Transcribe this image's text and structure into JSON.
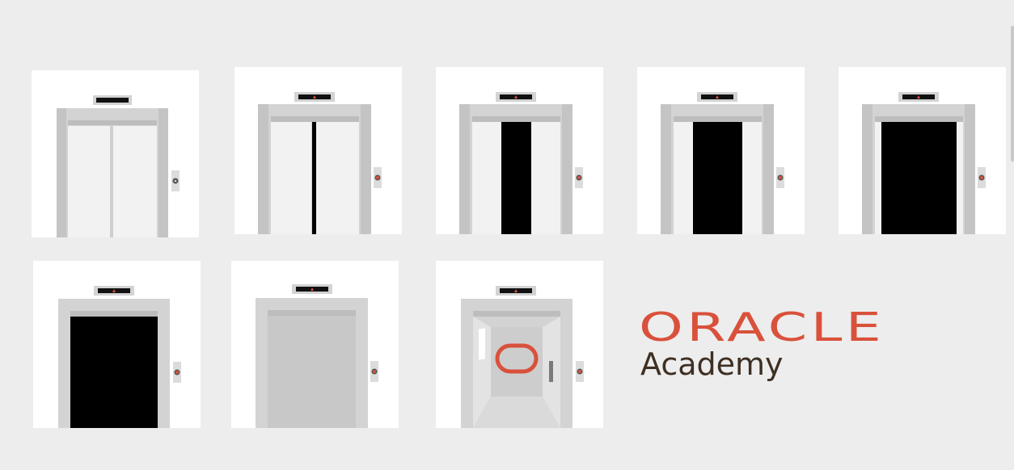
{
  "brand": {
    "wordmark": "ORACLE",
    "subtitle": "Academy",
    "wordmark_color": "#d9513b",
    "subtitle_color": "#3e2f23"
  },
  "frames": [
    {
      "id": 1,
      "state": "closed",
      "door_opening": 0.0,
      "indicator_icon": "up-arrow-icon"
    },
    {
      "id": 2,
      "state": "opening",
      "door_opening": 0.04,
      "indicator_icon": "up-arrow-icon"
    },
    {
      "id": 3,
      "state": "opening",
      "door_opening": 0.35,
      "indicator_icon": "up-arrow-icon"
    },
    {
      "id": 4,
      "state": "opening",
      "door_opening": 0.58,
      "indicator_icon": "up-arrow-icon"
    },
    {
      "id": 5,
      "state": "opening",
      "door_opening": 0.88,
      "indicator_icon": "up-arrow-icon"
    },
    {
      "id": 6,
      "state": "open-dark",
      "door_opening": 1.0,
      "indicator_icon": "up-arrow-icon"
    },
    {
      "id": 7,
      "state": "open-empty",
      "door_opening": 1.0,
      "indicator_icon": "up-arrow-icon"
    },
    {
      "id": 8,
      "state": "open-interior-logo",
      "door_opening": 1.0,
      "indicator_icon": "up-arrow-icon"
    }
  ],
  "colors": {
    "background": "#ededed",
    "card": "#ffffff",
    "frame": "#d3d3d3",
    "door": "#f1f1f1",
    "shaft": "#000000",
    "indicator_light": "#d9513b"
  }
}
